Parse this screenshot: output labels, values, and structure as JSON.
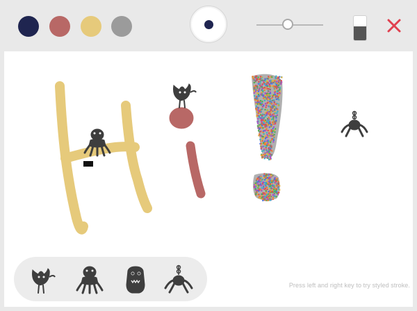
{
  "palette": {
    "colors": [
      "#1f2550",
      "#b86866",
      "#e6ca7b",
      "#9b9b9b"
    ],
    "selected_brush_color": "#1f2550"
  },
  "brush_size": {
    "value": 0.47
  },
  "eraser": {
    "level": 0.57
  },
  "icons": {
    "close": "close-icon",
    "stamps": [
      "bird-monster-icon",
      "squid-monster-icon",
      "furry-monster-icon",
      "spider-monster-icon"
    ]
  },
  "canvas": {
    "stroke_colors": {
      "H": "#e6ca7b",
      "i": "#b86866",
      "stamp": "#3e3e3e"
    }
  },
  "hint": {
    "text": "Press left and right key to try styled stroke."
  }
}
